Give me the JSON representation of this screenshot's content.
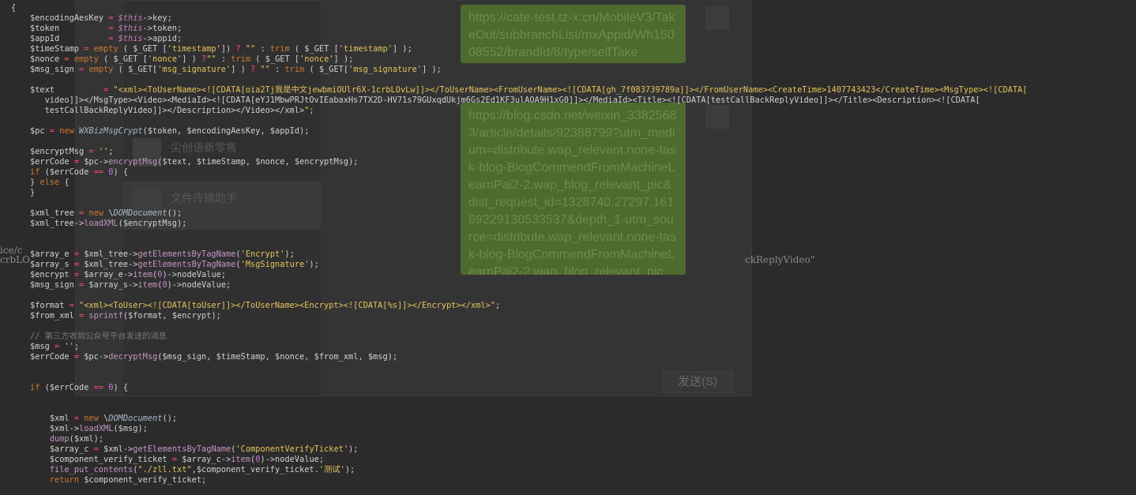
{
  "background_chat": {
    "messages": [
      {
        "text": "https://cate-test.tz-x.cn/MobileV3/TakeOut/subbranchList/mxAppid/Wh15008552/brandId/8/type/selfTake"
      },
      {
        "text": "https://blog.csdn.net/weixin_33825683/article/details/92388799?utm_medium=distribute.wap_relevant.none-task-blog-BlogCommendFromMachineLearnPai2-2.wap_blog_relevant_pic&dist_request_id=1328740.27297.16169229130533537&depth_1-utm_source=distribute.wap_relevant.none-task-blog-BlogCommendFromMachineLearnPai2-2.wap_blog_relevant_pic"
      }
    ],
    "list_items": [
      {
        "title": "尖创语新零售",
        "subtitle": ""
      },
      {
        "title": "文件传输助手",
        "subtitle": ""
      }
    ],
    "send_label": "发送(S)",
    "stray_left_a": "ice/c",
    "stray_left_b": "crbLO",
    "stray_right": "ckReplyVideo\""
  },
  "editor": {
    "lines": [
      "{",
      "$encodingAesKey = $this->key;",
      "$token          = $this->token;",
      "$appId          = $this->appid;",
      "$timeStamp = empty ( $_GET ['timestamp']) ? \"\" : trim ( $_GET ['timestamp'] );",
      "$nonce = empty ( $_GET ['nonce'] ) ?\"\" : trim ( $_GET ['nonce'] );",
      "$msg_sign = empty ( $_GET['msg_signature'] ) ? \"\" : trim ( $_GET['msg_signature'] );",
      "",
      "$text          = \"<xml><ToUserName><![CDATA[oia2Tj我是中文jewbmiOUlr6X-1crbLOvLw]]></ToUserName><FromUserName><![CDATA[gh_7f083739789a]]></FromUserName><CreateTime>1407743423</CreateTime><MsgType><![CDATA[",
      "   video]]></MsgType><Video><MediaId><![CDATA[eYJ1MbwPRJtOvIEabaxHs7TX2D-HV71s79GUxqdUkjm6Gs2Ed1KF3ulAOA9H1xG0]]></MediaId><Title><![CDATA[testCallBackReplyVideo]]></Title><Description><![CDATA[",
      "   testCallBackReplyVideo]]></Description></Video></xml>\";",
      "",
      "$pc = new WXBizMsgCrypt($token, $encodingAesKey, $appId);",
      "",
      "$encryptMsg = '';",
      "$errCode = $pc->encryptMsg($text, $timeStamp, $nonce, $encryptMsg);",
      "if ($errCode == 0) {",
      "} else {",
      "}",
      "",
      "$xml_tree = new \\DOMDocument();",
      "$xml_tree->loadXML($encryptMsg);",
      "",
      "",
      "$array_e = $xml_tree->getElementsByTagName('Encrypt');",
      "$array_s = $xml_tree->getElementsByTagName('MsgSignature');",
      "$encrypt = $array_e->item(0)->nodeValue;",
      "$msg_sign = $array_s->item(0)->nodeValue;",
      "",
      "$format = \"<xml><ToUser><![CDATA[toUser]]></ToUserName><Encrypt><![CDATA[%s]]></Encrypt></xml>\";",
      "$from_xml = sprintf($format, $encrypt);",
      "",
      "// 第三方收到公众号平台发送的消息",
      "$msg = '';",
      "$errCode = $pc->decryptMsg($msg_sign, $timeStamp, $nonce, $from_xml, $msg);",
      "",
      "",
      "if ($errCode == 0) {",
      "",
      "",
      "    $xml = new \\DOMDocument();",
      "    $xml->loadXML($msg);",
      "    dump($xml);",
      "    $array_c = $xml->getElementsByTagName('ComponentVerifyTicket');",
      "    $component_verify_ticket = $array_c->item(0)->nodeValue;",
      "    file_put_contents(\"./zll.txt\",$component_verify_ticket.'测试');",
      "    return $component_verify_ticket;"
    ]
  },
  "colors": {
    "background": "#2b2b2b",
    "keyword": "#cc7832",
    "string": "#e6c35c",
    "function": "#c594c5",
    "comment": "#7a7a7a",
    "bubble": "#4d6b2e"
  }
}
